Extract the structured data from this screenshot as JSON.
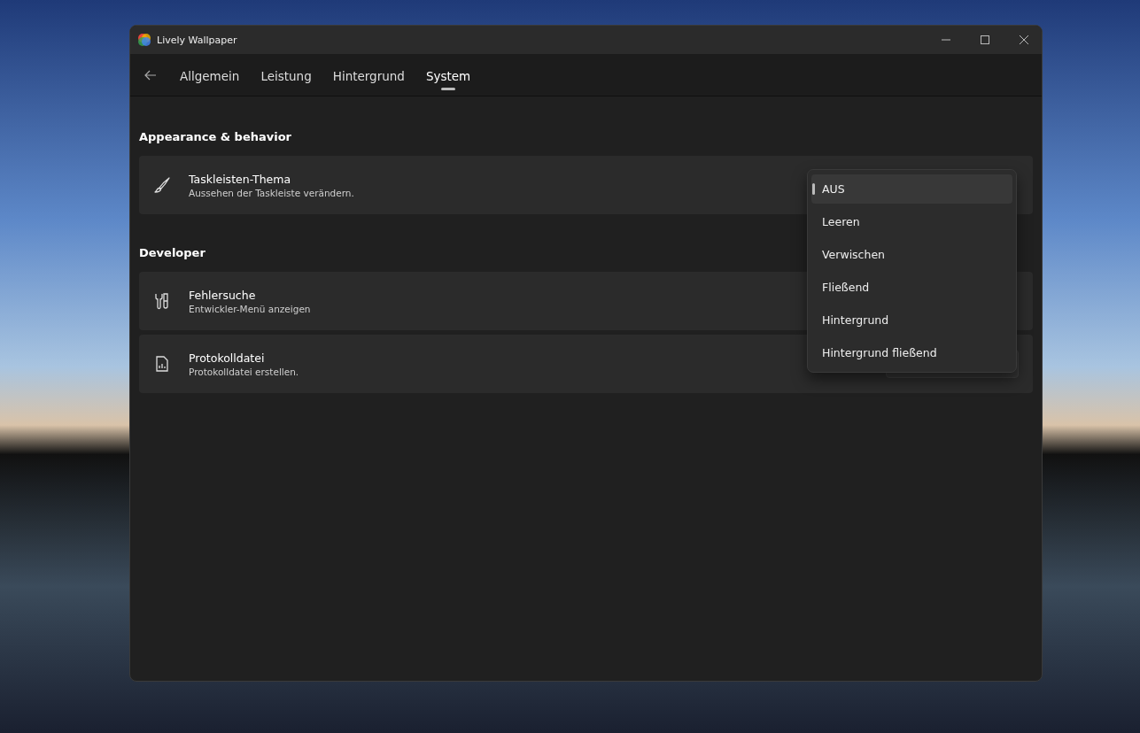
{
  "window": {
    "title": "Lively Wallpaper"
  },
  "tabs": [
    {
      "label": "Allgemein",
      "selected": false
    },
    {
      "label": "Leistung",
      "selected": false
    },
    {
      "label": "Hintergrund",
      "selected": false
    },
    {
      "label": "System",
      "selected": true
    }
  ],
  "sections": [
    {
      "heading": "Appearance & behavior",
      "cards": [
        {
          "kind": "brush",
          "title": "Taskleisten-Thema",
          "subtitle": "Aussehen der Taskleiste verändern."
        }
      ]
    },
    {
      "heading": "Developer",
      "cards": [
        {
          "kind": "tools",
          "title": "Fehlersuche",
          "subtitle": "Entwickler-Menü anzeigen"
        },
        {
          "kind": "file",
          "title": "Protokolldatei",
          "subtitle": "Protokolldatei erstellen."
        }
      ]
    }
  ],
  "dropdown": {
    "options": [
      {
        "label": "AUS",
        "selected": true
      },
      {
        "label": "Leeren",
        "selected": false
      },
      {
        "label": "Verwischen",
        "selected": false
      },
      {
        "label": "Fließend",
        "selected": false
      },
      {
        "label": "Hintergrund",
        "selected": false
      },
      {
        "label": "Hintergrund fließend",
        "selected": false
      }
    ]
  }
}
